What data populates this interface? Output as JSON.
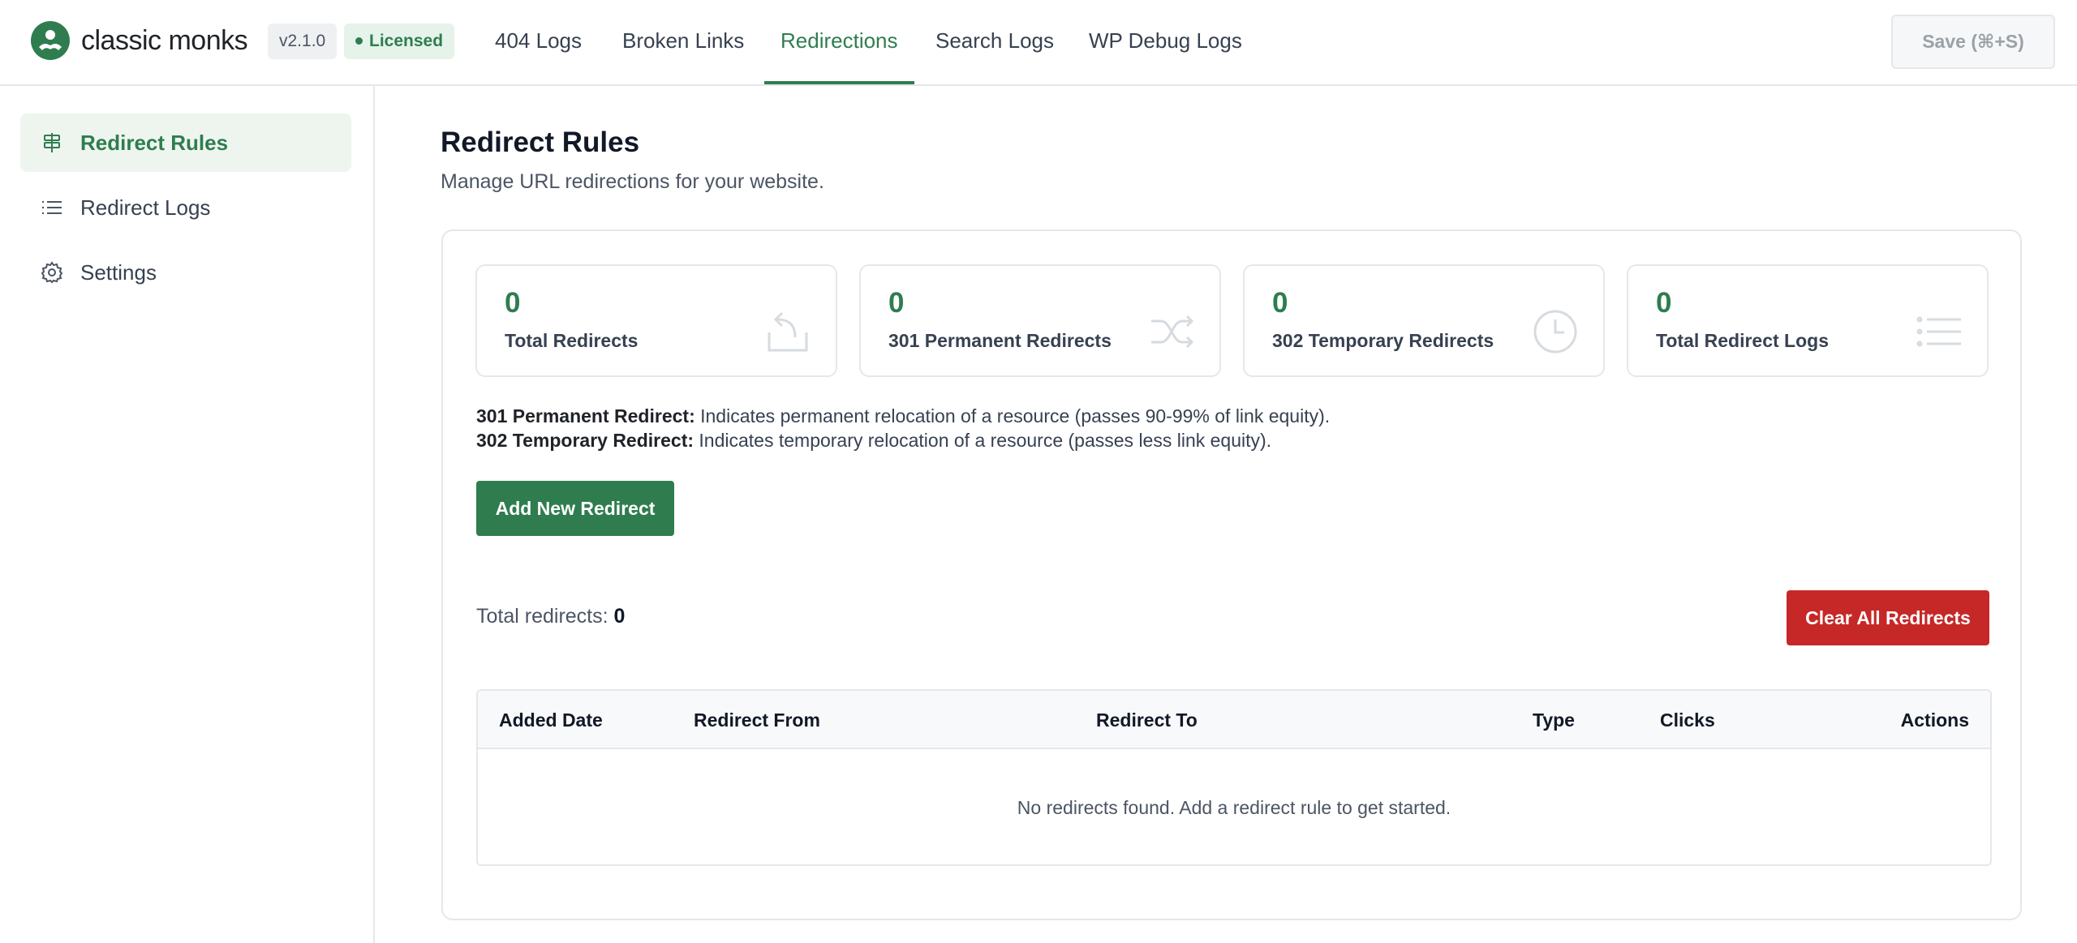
{
  "header": {
    "brand": "classic monks",
    "version": "v2.1.0",
    "license": "Licensed",
    "tabs": [
      {
        "label": "404 Logs",
        "active": false
      },
      {
        "label": "Broken Links",
        "active": false
      },
      {
        "label": "Redirections",
        "active": true
      },
      {
        "label": "Search Logs",
        "active": false
      },
      {
        "label": "WP Debug Logs",
        "active": false
      }
    ],
    "save_label": "Save (⌘+S)"
  },
  "sidebar": {
    "items": [
      {
        "label": "Redirect Rules",
        "icon": "signpost-icon",
        "active": true
      },
      {
        "label": "Redirect Logs",
        "icon": "list-icon",
        "active": false
      },
      {
        "label": "Settings",
        "icon": "gear-icon",
        "active": false
      }
    ]
  },
  "main": {
    "title": "Redirect Rules",
    "subtitle": "Manage URL redirections for your website.",
    "stats": [
      {
        "value": "0",
        "label": "Total Redirects",
        "icon": "redirect-icon"
      },
      {
        "value": "0",
        "label": "301 Permanent Redirects",
        "icon": "shuffle-icon"
      },
      {
        "value": "0",
        "label": "302 Temporary Redirects",
        "icon": "clock-icon"
      },
      {
        "value": "0",
        "label": "Total Redirect Logs",
        "icon": "list-icon"
      }
    ],
    "info": [
      {
        "term": "301 Permanent Redirect:",
        "text": " Indicates permanent relocation of a resource (passes 90-99% of link equity)."
      },
      {
        "term": "302 Temporary Redirect:",
        "text": " Indicates temporary relocation of a resource (passes less link equity)."
      }
    ],
    "add_button": "Add New Redirect",
    "total_label": "Total redirects: ",
    "total_value": "0",
    "clear_button": "Clear All Redirects",
    "table": {
      "columns": [
        "Added Date",
        "Redirect From",
        "Redirect To",
        "Type",
        "Clicks",
        "Actions"
      ],
      "empty_message": "No redirects found. Add a redirect rule to get started."
    }
  },
  "colors": {
    "accent": "#2f7d4f",
    "danger": "#c62828"
  }
}
